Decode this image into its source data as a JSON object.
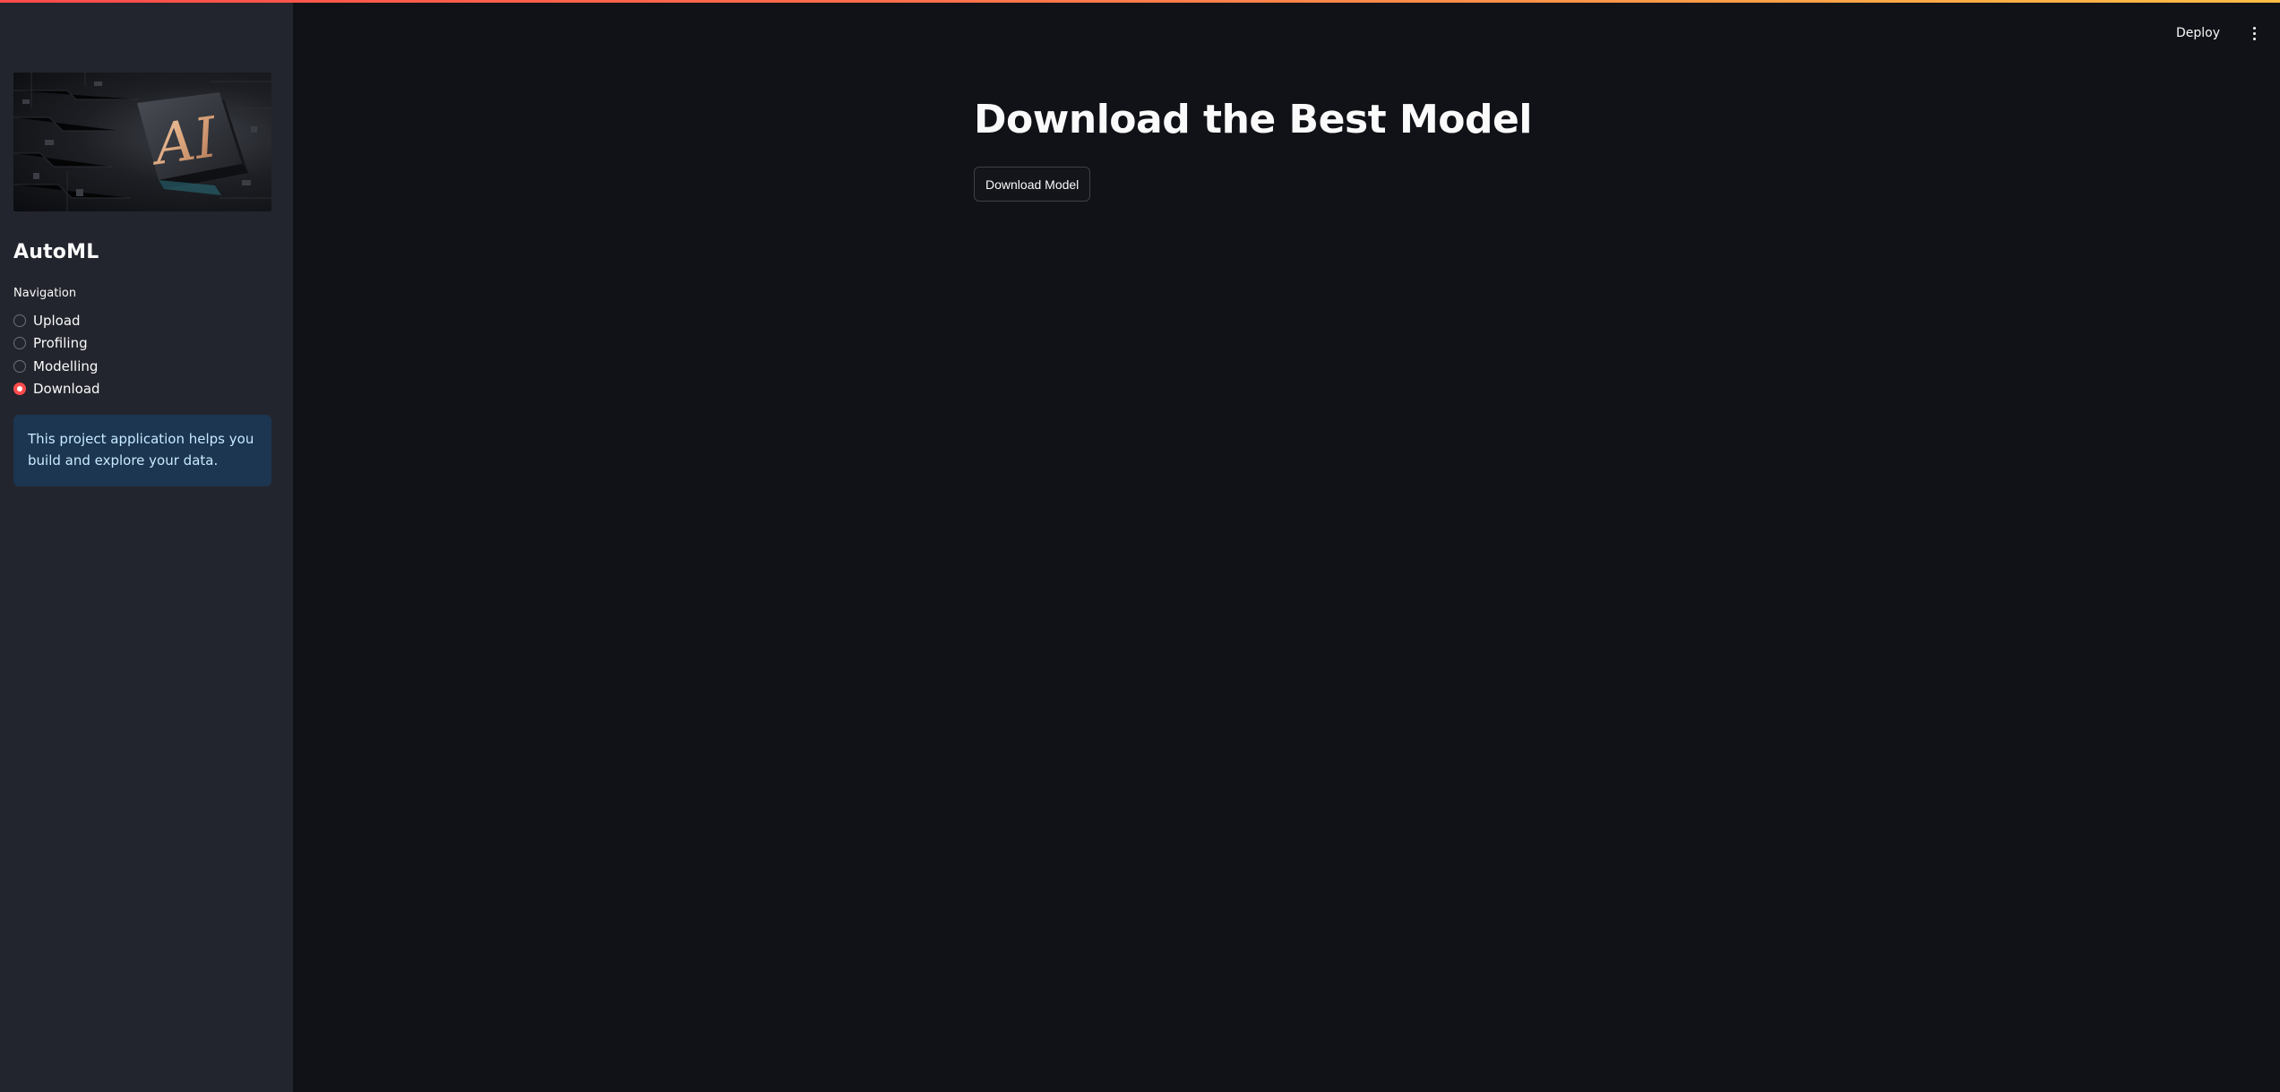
{
  "header": {
    "deploy_label": "Deploy",
    "menu_icon": "kebab-menu-icon"
  },
  "sidebar": {
    "image_text": "AI",
    "title": "AutoML",
    "navigation_label": "Navigation",
    "nav_options": [
      {
        "label": "Upload",
        "selected": false
      },
      {
        "label": "Profiling",
        "selected": false
      },
      {
        "label": "Modelling",
        "selected": false
      },
      {
        "label": "Download",
        "selected": true
      }
    ],
    "info_text": "This project application helps you build and explore your data."
  },
  "main": {
    "title": "Download the Best Model",
    "download_button_label": "Download Model"
  },
  "colors": {
    "background": "#0e1117",
    "sidebar_background": "#262730",
    "accent": "#ff4b4b",
    "info_background": "#1c3550",
    "info_text": "#c7ebff"
  }
}
